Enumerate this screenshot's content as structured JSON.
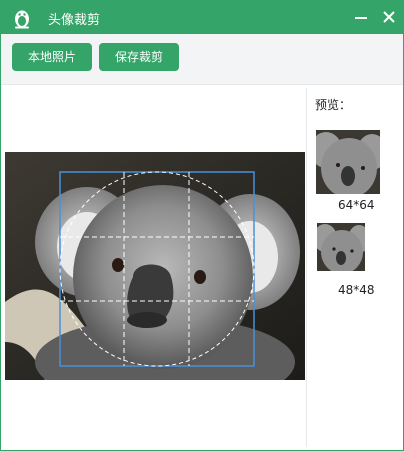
{
  "window": {
    "title": "头像裁剪"
  },
  "titlebar": {
    "icon": "penguin-avatar-icon",
    "controls": [
      "minimize-icon",
      "close-icon"
    ]
  },
  "toolbar": {
    "local_photo_label": "本地照片",
    "save_crop_label": "保存裁剪"
  },
  "preview": {
    "label": "预览：",
    "sizes": [
      {
        "caption": "64*64"
      },
      {
        "caption": "48*48"
      }
    ]
  },
  "colors": {
    "accent": "#34a468",
    "toolbar_bg": "#f3f4f5",
    "crop_border": "#4a90d9"
  }
}
